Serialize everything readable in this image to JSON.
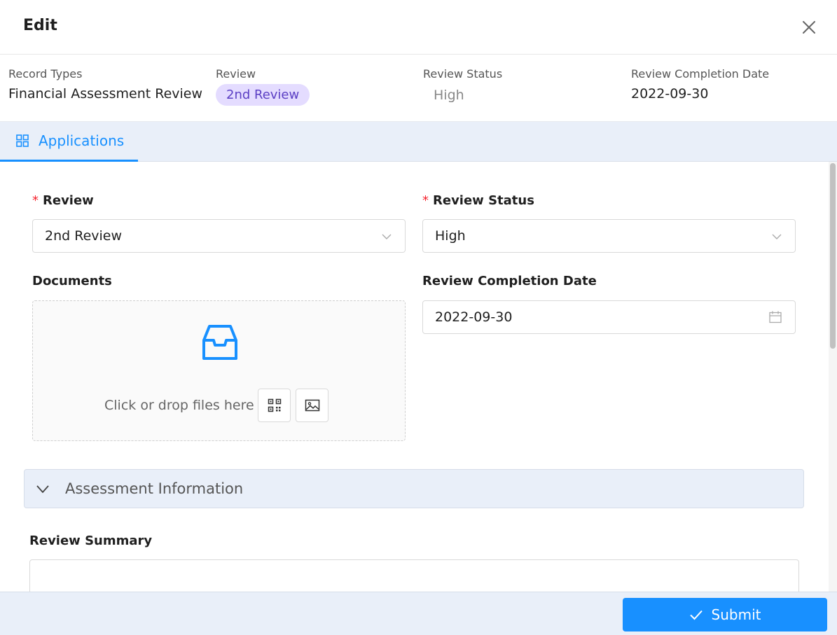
{
  "header": {
    "title": "Edit"
  },
  "summary": {
    "record_types_label": "Record Types",
    "record_types_value": "Financial Assessment Review",
    "review_label": "Review",
    "review_value": "2nd Review",
    "review_status_label": "Review Status",
    "review_status_value": "High",
    "completion_date_label": "Review Completion Date",
    "completion_date_value": "2022-09-30"
  },
  "tabs": [
    {
      "label": "Applications",
      "active": true
    }
  ],
  "form": {
    "review": {
      "label": "Review",
      "required_mark": "*",
      "value": "2nd Review"
    },
    "review_status": {
      "label": "Review Status",
      "required_mark": "*",
      "value": "High"
    },
    "documents": {
      "label": "Documents",
      "hint": "Click or drop files here"
    },
    "completion_date": {
      "label": "Review Completion Date",
      "value": "2022-09-30"
    },
    "assessment_section": {
      "label": "Assessment Information"
    },
    "review_summary": {
      "label": "Review Summary",
      "value": ""
    }
  },
  "footer": {
    "submit_label": "Submit"
  },
  "colors": {
    "primary": "#1890ff",
    "tag_bg": "#e4dcff",
    "tag_text": "#5b3fc4",
    "required": "#f5222d",
    "band_bg": "#e9eff9"
  },
  "icons": {
    "close": "close-icon",
    "tab": "grid-icon",
    "chevron": "chevron-down-icon",
    "calendar": "calendar-icon",
    "upload": "inbox-icon",
    "qr": "qr-code-icon",
    "image": "image-icon",
    "check": "check-icon"
  }
}
